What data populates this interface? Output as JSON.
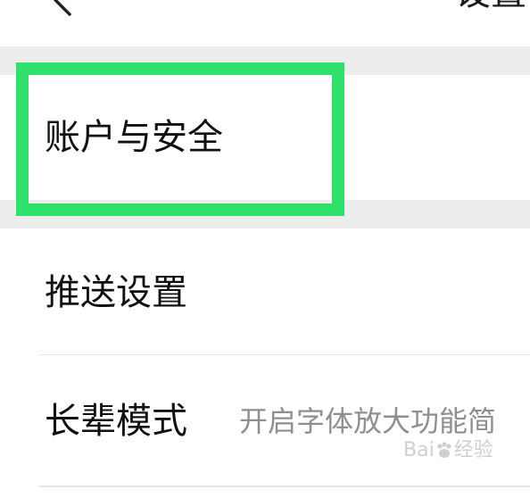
{
  "header": {
    "title": "设置"
  },
  "settings": {
    "items": [
      {
        "label": "账户与安全"
      },
      {
        "label": "推送设置"
      },
      {
        "label": "长辈模式",
        "description": "开启字体放大功能简"
      }
    ]
  },
  "annotation": {
    "highlight_color": "#2fe06a"
  },
  "watermark": {
    "text_left": "Bai",
    "text_right": "经验"
  }
}
